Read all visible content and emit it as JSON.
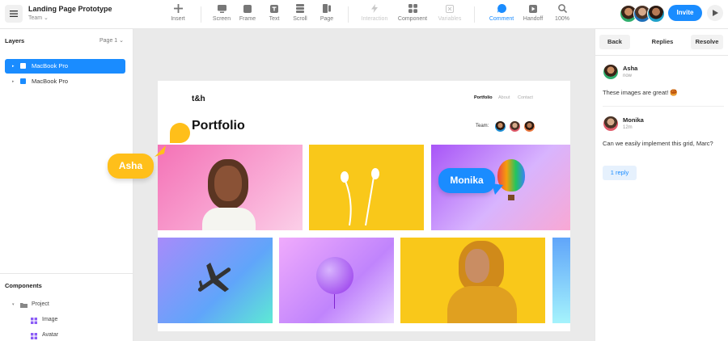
{
  "app": {
    "title": "Landing Page Prototype",
    "team": "Team ⌄"
  },
  "toolbar": {
    "tools": [
      {
        "label": "Insert",
        "icon": "plus-icon"
      },
      {
        "label": "Screen",
        "icon": "screen-icon"
      },
      {
        "label": "Frame",
        "icon": "frame-icon"
      },
      {
        "label": "Text",
        "icon": "text-icon"
      },
      {
        "label": "Scroll",
        "icon": "scroll-icon"
      },
      {
        "label": "Page",
        "icon": "page-icon"
      },
      {
        "label": "Interaction",
        "icon": "lightning-icon"
      },
      {
        "label": "Component",
        "icon": "component-icon"
      },
      {
        "label": "Variables",
        "icon": "variables-icon"
      },
      {
        "label": "Comment",
        "icon": "comment-icon"
      },
      {
        "label": "Handoff",
        "icon": "handoff-icon"
      },
      {
        "label": "100%",
        "icon": "zoom-icon"
      }
    ],
    "invite_label": "Invite"
  },
  "layers": {
    "title": "Layers",
    "page_selector": "Page 1 ⌄",
    "items": [
      {
        "label": "MacBook Pro",
        "selected": true
      },
      {
        "label": "MacBook Pro",
        "selected": false
      }
    ]
  },
  "components": {
    "title": "Components",
    "folder": "Project",
    "items": [
      {
        "label": "Image"
      },
      {
        "label": "Avatar"
      }
    ]
  },
  "artboard": {
    "logo": "t&h",
    "nav": [
      "Portfolio",
      "About",
      "Contact"
    ],
    "heading": "Portfolio",
    "team_label": "Team:"
  },
  "cursors": {
    "asha": "Asha",
    "monika": "Monika"
  },
  "comments_panel": {
    "back_label": "Back",
    "replies_label": "Replies",
    "resolve_label": "Resolve",
    "comments": [
      {
        "author": "Asha",
        "time": "now",
        "text": "These images are great! 🥮"
      },
      {
        "author": "Monika",
        "time": "12m",
        "text": "Can we easily implement this grid, Marc?"
      }
    ],
    "reply_button": "1 reply"
  },
  "colors": {
    "accent": "#1a8cff",
    "asha_cursor": "#ffbf1a",
    "monika_cursor": "#1a8cff"
  }
}
